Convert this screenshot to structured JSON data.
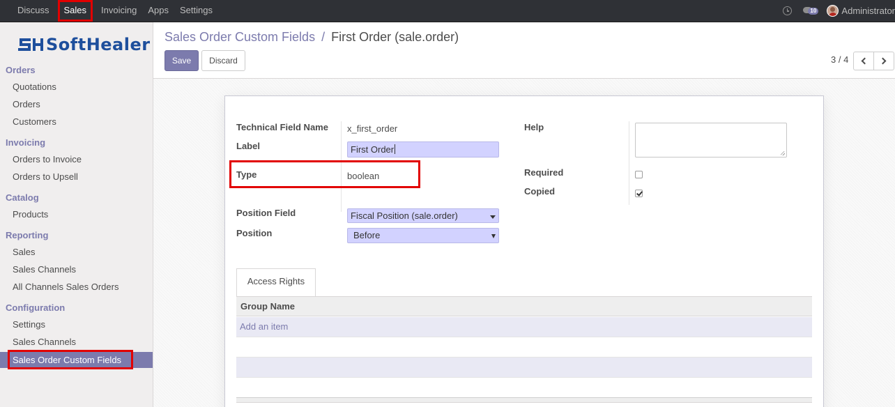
{
  "topbar": {
    "menu": [
      "Discuss",
      "Sales",
      "Invoicing",
      "Apps",
      "Settings"
    ],
    "active": "Sales",
    "chat_count": "10",
    "user": "Administrator"
  },
  "sidebar": {
    "brand": "SoftHealer",
    "brand_mark": "SH",
    "sections": [
      {
        "title": "Orders",
        "items": [
          "Quotations",
          "Orders",
          "Customers"
        ]
      },
      {
        "title": "Invoicing",
        "items": [
          "Orders to Invoice",
          "Orders to Upsell"
        ]
      },
      {
        "title": "Catalog",
        "items": [
          "Products"
        ]
      },
      {
        "title": "Reporting",
        "items": [
          "Sales",
          "Sales Channels",
          "All Channels Sales Orders"
        ]
      },
      {
        "title": "Configuration",
        "items": [
          "Settings",
          "Sales Channels",
          "Sales Order Custom Fields"
        ]
      }
    ],
    "active_item": "Sales Order Custom Fields"
  },
  "header": {
    "breadcrumb_parent": "Sales Order Custom Fields",
    "breadcrumb_sep": "/",
    "breadcrumb_current": "First Order (sale.order)",
    "save_label": "Save",
    "discard_label": "Discard",
    "pager": "3 / 4"
  },
  "form": {
    "technical_field_name_label": "Technical Field Name",
    "technical_field_name_value": "x_first_order",
    "label_label": "Label",
    "label_value": "First Order",
    "type_label": "Type",
    "type_value": "boolean",
    "position_field_label": "Position Field",
    "position_field_value": "Fiscal Position (sale.order)",
    "position_label": "Position",
    "position_value": "Before",
    "help_label": "Help",
    "help_value": "",
    "required_label": "Required",
    "required_checked": false,
    "copied_label": "Copied",
    "copied_checked": true
  },
  "access": {
    "tab_label": "Access Rights",
    "column_header": "Group Name",
    "add_item": "Add an item"
  },
  "colors": {
    "brand": "#7c7bad",
    "highlight": "#e20000",
    "navbar": "#2f3136",
    "input_bg": "#d2d2ff"
  }
}
